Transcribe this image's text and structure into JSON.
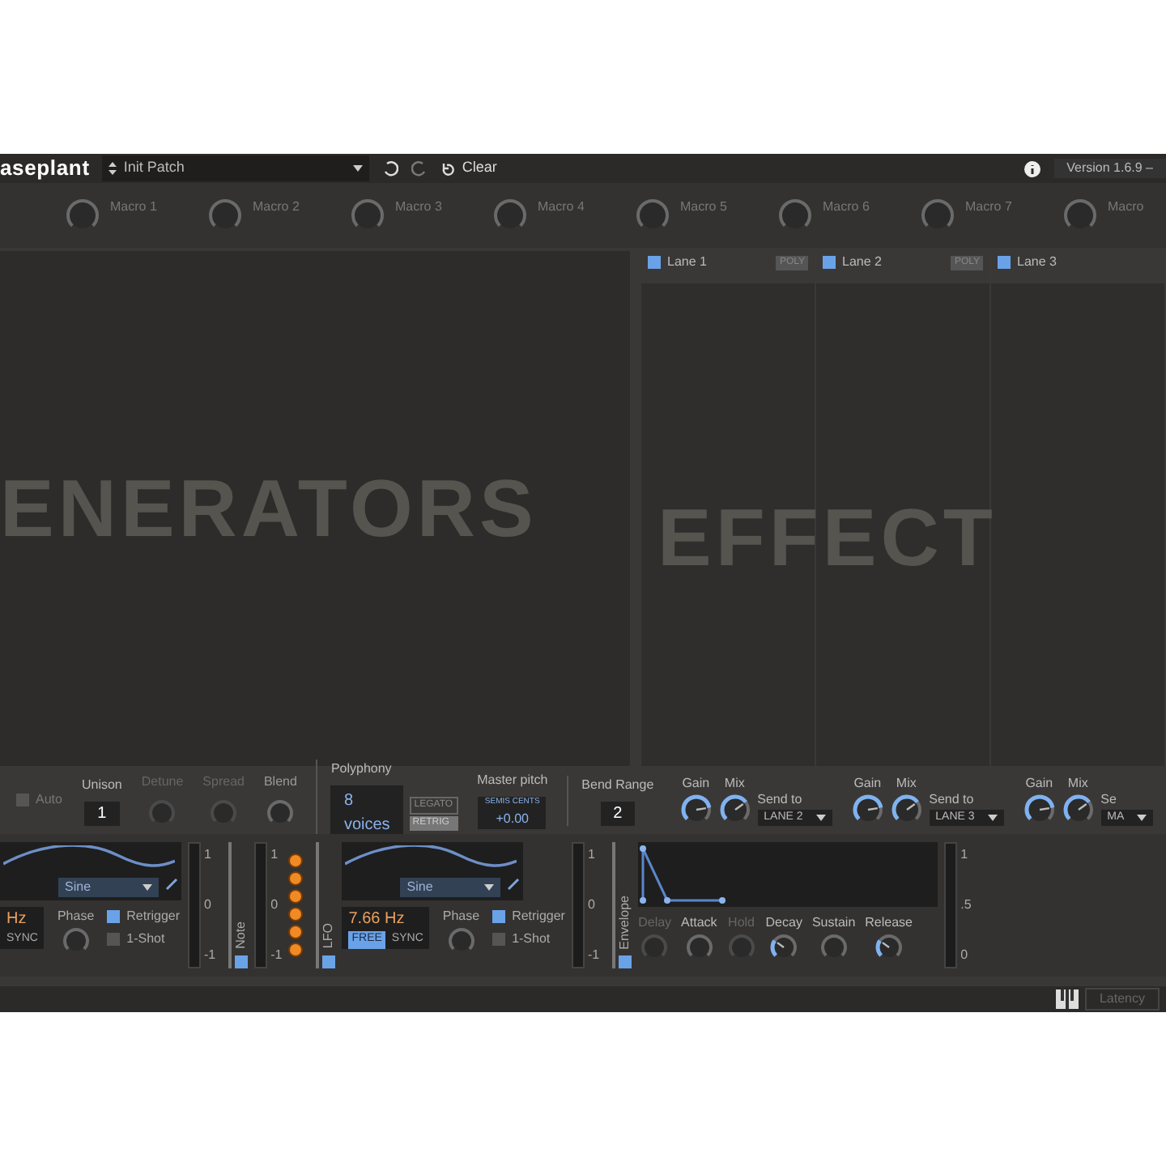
{
  "header": {
    "logo": "aseplant",
    "patch_name": "Init Patch",
    "clear": "Clear",
    "version": "Version 1.6.9 –"
  },
  "macros": [
    {
      "label": "Macro 1"
    },
    {
      "label": "Macro 2"
    },
    {
      "label": "Macro 3"
    },
    {
      "label": "Macro 4"
    },
    {
      "label": "Macro 5"
    },
    {
      "label": "Macro 6"
    },
    {
      "label": "Macro 7"
    },
    {
      "label": "Macro"
    }
  ],
  "generators": {
    "title": "ENERATORS"
  },
  "effects": {
    "title": "EFFECT",
    "lanes": [
      {
        "name": "Lane 1",
        "enabled": true,
        "badge": "POLY"
      },
      {
        "name": "Lane 2",
        "enabled": true,
        "badge": "POLY"
      },
      {
        "name": "Lane 3",
        "enabled": true
      }
    ]
  },
  "voice": {
    "auto": {
      "label": "Auto",
      "checked": false
    },
    "unison": {
      "label": "Unison",
      "value": "1"
    },
    "knobs": [
      {
        "label": "Detune",
        "disabled": true
      },
      {
        "label": "Spread",
        "disabled": true
      },
      {
        "label": "Blend",
        "disabled": false
      }
    ],
    "polyphony": {
      "label": "Polyphony",
      "value": "8 voices",
      "legato": {
        "label": "LEGATO",
        "on": false
      },
      "retrig": {
        "label": "RETRIG",
        "on": true
      }
    },
    "master_pitch": {
      "label": "Master pitch",
      "units": "SEMIS CENTS",
      "value": "+0.00"
    },
    "bend": {
      "label": "Bend Range",
      "value": "2"
    }
  },
  "lane_controls": [
    {
      "gain": {
        "label": "Gain",
        "level": 0.8
      },
      "mix": {
        "label": "Mix",
        "level": 0.7
      },
      "send_label": "Send to",
      "send": "LANE 2"
    },
    {
      "gain": {
        "label": "Gain",
        "level": 0.8
      },
      "mix": {
        "label": "Mix",
        "level": 0.7
      },
      "send_label": "Send to",
      "send": "LANE 3"
    },
    {
      "gain": {
        "label": "Gain",
        "level": 0.8
      },
      "mix": {
        "label": "Mix",
        "level": 0.7
      },
      "send_label": "Se",
      "send": "MA"
    }
  ],
  "modulators": [
    {
      "kind": "lfo",
      "shape": "Sine",
      "rate": "Hz",
      "sync": "SYNC",
      "phase": "Phase",
      "retrigger": {
        "label": "Retrigger",
        "checked": true
      },
      "oneshot": {
        "label": "1-Shot",
        "checked": false
      },
      "scale": [
        "1",
        "0",
        "-1"
      ]
    },
    {
      "kind": "note",
      "title": "Note",
      "enabled": true,
      "scale": [
        "1",
        "0",
        "-1"
      ]
    },
    {
      "kind": "lfo",
      "title": "LFO",
      "enabled": true,
      "shape": "Sine",
      "rate": "7.66 Hz",
      "free": "FREE",
      "sync": "SYNC",
      "phase": "Phase",
      "retrigger": {
        "label": "Retrigger",
        "checked": true
      },
      "oneshot": {
        "label": "1-Shot",
        "checked": false
      },
      "scale": [
        "1",
        "0",
        "-1"
      ]
    },
    {
      "kind": "envelope",
      "title": "Envelope",
      "enabled": true,
      "knobs": [
        {
          "label": "Delay",
          "disabled": true
        },
        {
          "label": "Attack",
          "disabled": false
        },
        {
          "label": "Hold",
          "disabled": true
        },
        {
          "label": "Decay",
          "disabled": false,
          "level": 0.3
        },
        {
          "label": "Sustain",
          "disabled": false
        },
        {
          "label": "Release",
          "disabled": false,
          "level": 0.3
        }
      ],
      "scale": [
        "1",
        ".5",
        "0"
      ]
    }
  ],
  "status_bar": {
    "latency": "Latency"
  }
}
